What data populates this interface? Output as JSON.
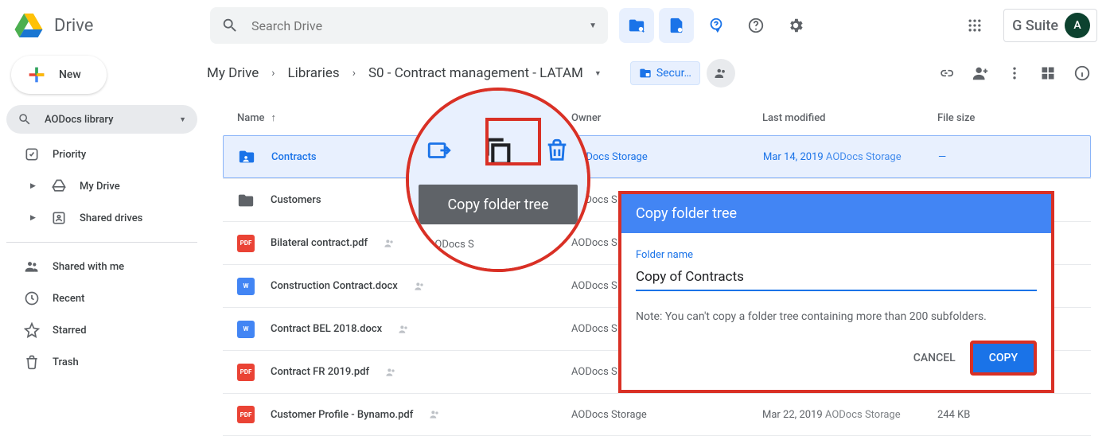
{
  "header": {
    "app_name": "Drive",
    "search_placeholder": "Search Drive",
    "avatar_initial": "A",
    "gsuite_label": "G Suite"
  },
  "sidebar": {
    "new_label": "New",
    "collection_label": "AODocs library",
    "items": [
      {
        "label": "Priority"
      },
      {
        "label": "My Drive"
      },
      {
        "label": "Shared drives"
      },
      {
        "label": "Shared with me"
      },
      {
        "label": "Recent"
      },
      {
        "label": "Starred"
      },
      {
        "label": "Trash"
      }
    ]
  },
  "breadcrumbs": {
    "a": "My Drive",
    "b": "Libraries",
    "c": "S0 - Contract management - LATAM"
  },
  "pill_label": "Secur…",
  "columns": {
    "name": "Name",
    "owner": "Owner",
    "modified": "Last modified",
    "size": "File size"
  },
  "rows": [
    {
      "type": "folder-shared",
      "name": "Contracts",
      "owner": "AODocs Storage",
      "modified": "Mar 14, 2019",
      "mod_by": "AODocs Storage",
      "size": "—",
      "selected": true
    },
    {
      "type": "folder",
      "name": "Customers",
      "owner": "AODocs S",
      "modified": "",
      "mod_by": "",
      "size": ""
    },
    {
      "type": "pdf",
      "name": "Bilateral contract.pdf",
      "owner": "AODocs S",
      "modified": "",
      "mod_by": "",
      "size": "",
      "shared": true
    },
    {
      "type": "doc",
      "name": "Construction Contract.docx",
      "owner": "AODocs S",
      "modified": "",
      "mod_by": "",
      "size": "",
      "shared": true
    },
    {
      "type": "doc",
      "name": "Contract BEL 2018.docx",
      "owner": "AODocs S",
      "modified": "",
      "mod_by": "",
      "size": "",
      "shared": true
    },
    {
      "type": "pdf",
      "name": "Contract FR 2019.pdf",
      "owner": "AODocs S",
      "modified": "",
      "mod_by": "",
      "size": "",
      "shared": true
    },
    {
      "type": "pdf",
      "name": "Customer Profile - Bynamo.pdf",
      "owner": "AODocs Storage",
      "modified": "Mar 22, 2019",
      "mod_by": "AODocs Storage",
      "size": "244 KB",
      "shared": true
    }
  ],
  "annotation": {
    "tooltip": "Copy folder tree",
    "under_owner": "AODocs S"
  },
  "dialog": {
    "title": "Copy folder tree",
    "label": "Folder name",
    "value": "Copy of Contracts",
    "note": "Note: You can't copy a folder tree containing more than 200 subfolders.",
    "cancel": "CANCEL",
    "submit": "COPY"
  }
}
